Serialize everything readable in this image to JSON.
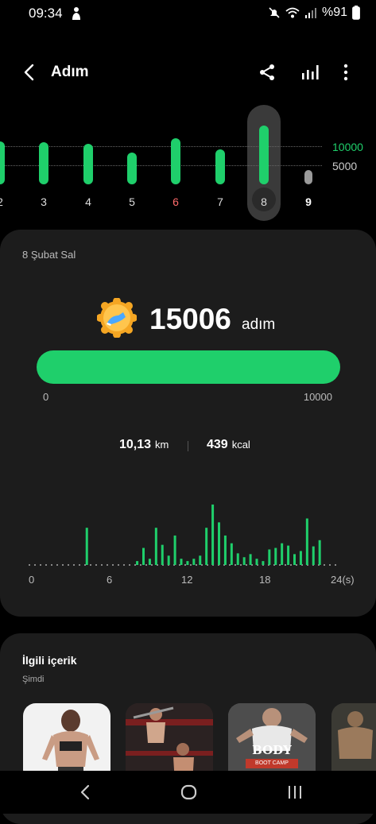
{
  "status_bar": {
    "time": "09:34",
    "battery": "%91",
    "icons": [
      "android-person-icon",
      "mute-icon",
      "wifi-icon",
      "signal-icon",
      "signal-icon"
    ]
  },
  "header": {
    "title": "Adım",
    "actions": [
      "share-icon",
      "bar-stats-icon",
      "more-vert-icon"
    ]
  },
  "week_chart": {
    "grid_labels": [
      "10000",
      "5000"
    ],
    "days": [
      {
        "label": "2",
        "steps": 11000,
        "color": "#dddddd"
      },
      {
        "label": "3",
        "steps": 10800,
        "color": "#dddddd"
      },
      {
        "label": "4",
        "steps": 10500,
        "color": "#dddddd"
      },
      {
        "label": "5",
        "steps": 8100,
        "color": "#dddddd"
      },
      {
        "label": "6",
        "steps": 11800,
        "color": "#ff6b6b"
      },
      {
        "label": "7",
        "steps": 8900,
        "color": "#dddddd"
      },
      {
        "label": "8",
        "steps": 15006,
        "color": "#dddddd"
      },
      {
        "label": "9",
        "steps": 2000,
        "color": "#ffffff"
      }
    ],
    "accent": "#1fcf6b"
  },
  "day_detail": {
    "date": "8 Şubat Sal",
    "steps": "15006",
    "steps_unit": "adım",
    "goal_min": "0",
    "goal_max": "10000",
    "goal_progress": 1.0,
    "distance": "10,13",
    "distance_unit": "km",
    "calories": "439",
    "calories_unit": "kcal"
  },
  "chart_data": {
    "type": "bar",
    "title": "",
    "xlabel": "",
    "ylabel": "",
    "x_ticks": [
      "0",
      "6",
      "12",
      "18",
      "24(s)"
    ],
    "x": [
      0,
      0.5,
      1,
      1.5,
      2,
      2.5,
      3,
      3.5,
      4,
      4.5,
      5,
      5.5,
      6,
      6.5,
      7,
      7.5,
      8,
      8.5,
      9,
      9.5,
      10,
      10.5,
      11,
      11.5,
      12,
      12.5,
      13,
      13.5,
      14,
      14.5,
      15,
      15.5,
      16,
      16.5,
      17,
      17.5,
      18,
      18.5,
      19,
      19.5,
      20,
      20.5,
      21,
      21.5,
      22,
      22.5,
      23,
      23.5
    ],
    "values": [
      0,
      0,
      0,
      0,
      0,
      0,
      0,
      0,
      0,
      48,
      0,
      0,
      0,
      0,
      0,
      0,
      0,
      5,
      22,
      8,
      48,
      26,
      12,
      38,
      8,
      5,
      8,
      12,
      48,
      78,
      55,
      38,
      28,
      15,
      10,
      14,
      8,
      5,
      20,
      22,
      28,
      25,
      14,
      18,
      60,
      24,
      32,
      0
    ],
    "accent": "#1fcf6b"
  },
  "related": {
    "title": "İlgili içerik",
    "subtitle": "Şimdi",
    "items": [
      {
        "name": "fitness-woman-thumb",
        "caption": ""
      },
      {
        "name": "gym-training-thumb",
        "caption": ""
      },
      {
        "name": "body-blast-thumb",
        "caption": "BODY BLAST",
        "caption_sub": "BOOT CAMP"
      },
      {
        "name": "muscle-man-thumb",
        "caption": ""
      }
    ]
  },
  "nav_bar": {
    "buttons": [
      "back-nav-icon",
      "home-nav-icon",
      "recents-nav-icon"
    ]
  }
}
